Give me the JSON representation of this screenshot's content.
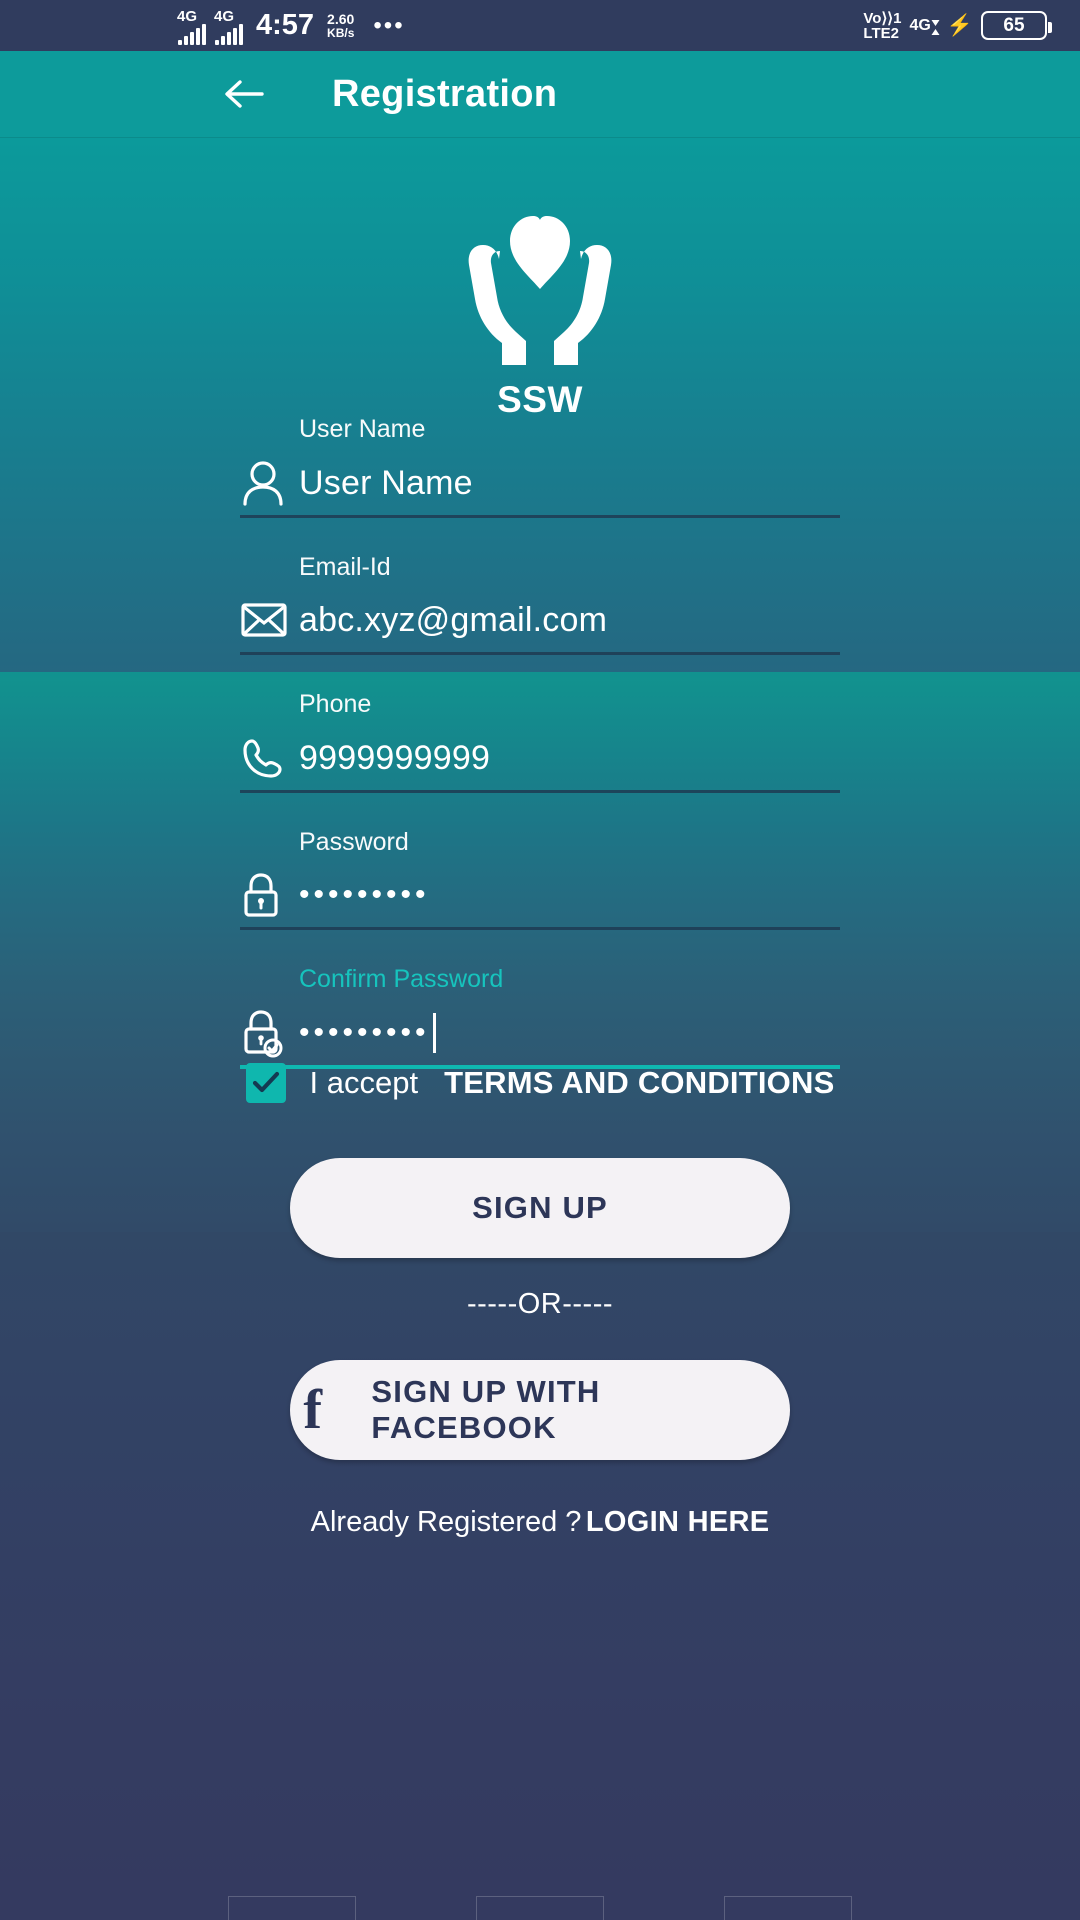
{
  "statusbar": {
    "sim1_network": "4G",
    "sim2_network": "4G",
    "time": "4:57",
    "net_speed_value": "2.60",
    "net_speed_unit": "KB/s",
    "overflow": "•••",
    "volte_line1": "Vo⟩⟩1",
    "volte_line2": "LTE2",
    "data_network": "4G",
    "charging": "⚡",
    "battery_percent": "65"
  },
  "appbar": {
    "back_icon": "arrow-left-icon",
    "title": "Registration"
  },
  "logo": {
    "icon": "heart-in-hands-icon",
    "text": "SSW"
  },
  "form": {
    "fields": [
      {
        "label": "User Name",
        "value": "User Name",
        "placeholder": "User Name",
        "icon": "user-icon",
        "focused": false,
        "masked": false
      },
      {
        "label": "Email-Id",
        "value": "abc.xyz@gmail.com",
        "placeholder": "Email-Id",
        "icon": "envelope-icon",
        "focused": false,
        "masked": false
      },
      {
        "label": "Phone",
        "value": "9999999999",
        "placeholder": "Phone",
        "icon": "phone-icon",
        "focused": false,
        "masked": false
      },
      {
        "label": "Password",
        "value": "•••••••••",
        "placeholder": "Password",
        "icon": "lock-icon",
        "focused": false,
        "masked": true
      },
      {
        "label": "Confirm Password",
        "value": "•••••••••",
        "placeholder": "Confirm Password",
        "icon": "lock-check-icon",
        "focused": true,
        "masked": true
      }
    ]
  },
  "terms": {
    "checked": true,
    "accept_text": "I accept",
    "link_text": "TERMS AND CONDITIONS"
  },
  "actions": {
    "signup_label": "SIGN UP",
    "or_divider": "-----OR-----",
    "facebook_label": "SIGN UP WITH FACEBOOK",
    "facebook_icon": "facebook-icon"
  },
  "footer": {
    "text": "Already Registered ?",
    "link": "LOGIN HERE"
  },
  "colors": {
    "appbar": "#0d9b9b",
    "accent_teal": "#0fb8b0",
    "background_top": "#0c9a9b",
    "background_bottom": "#343a60",
    "button_bg": "#f4f2f5",
    "button_text": "#2d3658"
  }
}
